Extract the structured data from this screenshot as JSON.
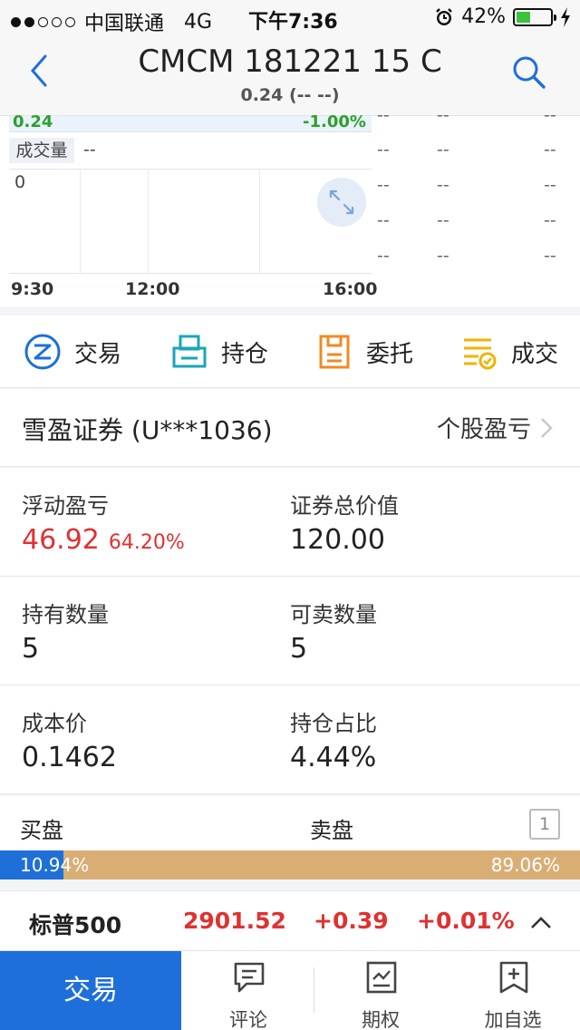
{
  "status_bar": {
    "carrier": "中国联通",
    "network": "4G",
    "time": "下午7:36",
    "battery": "42%",
    "battery_level": 0.42
  },
  "header": {
    "title": "CMCM 181221 15 C",
    "subtitle": "0.24 (-- --)"
  },
  "chart": {
    "top_price": "0.24",
    "top_percent": "-1.00%",
    "volume_label": "成交量",
    "volume_value": "--",
    "volume_zero": "0",
    "time_ticks": [
      "9:30",
      "12:00",
      "16:00"
    ],
    "side_rows": [
      [
        "--",
        "--",
        "--"
      ],
      [
        "--",
        "--",
        "--"
      ],
      [
        "--",
        "--",
        "--"
      ],
      [
        "--",
        "--",
        "--"
      ],
      [
        "--",
        "--",
        "--"
      ]
    ],
    "colors": {
      "down": "#2ca02c",
      "grid": "#dde3ea",
      "highlight": "#eaf2fc"
    }
  },
  "actions": [
    {
      "label": "交易",
      "icon": "trade-z-icon",
      "color": "#1e6fd9"
    },
    {
      "label": "持仓",
      "icon": "position-printer-icon",
      "color": "#1aa6b7"
    },
    {
      "label": "委托",
      "icon": "order-clipboard-icon",
      "color": "#f08a24"
    },
    {
      "label": "成交",
      "icon": "deal-list-check-icon",
      "color": "#f0b400"
    }
  ],
  "account": {
    "name": "雪盈证券 (U***1036)",
    "link": "个股盈亏"
  },
  "metrics": {
    "floating_pl_label": "浮动盈亏",
    "floating_pl_value": "46.92",
    "floating_pl_percent": "64.20%",
    "total_value_label": "证券总价值",
    "total_value": "120.00",
    "holding_qty_label": "持有数量",
    "holding_qty": "5",
    "sellable_qty_label": "可卖数量",
    "sellable_qty": "5",
    "cost_label": "成本价",
    "cost": "0.1462",
    "position_ratio_label": "持仓占比",
    "position_ratio": "4.44%"
  },
  "order_book": {
    "buy_label": "买盘",
    "sell_label": "卖盘",
    "level": "1",
    "buy_percent": "10.94%",
    "sell_percent": "89.06%",
    "buy_fraction": 0.1094,
    "colors": {
      "buy": "#1f6fd8",
      "sell": "#d9ae75"
    }
  },
  "ticker": {
    "name": "标普500",
    "price": "2901.52",
    "change": "+0.39",
    "change_percent": "+0.01%"
  },
  "tabbar": {
    "trade": "交易",
    "items": [
      {
        "label": "评论",
        "icon": "comment-icon"
      },
      {
        "label": "期权",
        "icon": "options-chart-icon"
      },
      {
        "label": "加自选",
        "icon": "add-watchlist-icon"
      }
    ]
  }
}
